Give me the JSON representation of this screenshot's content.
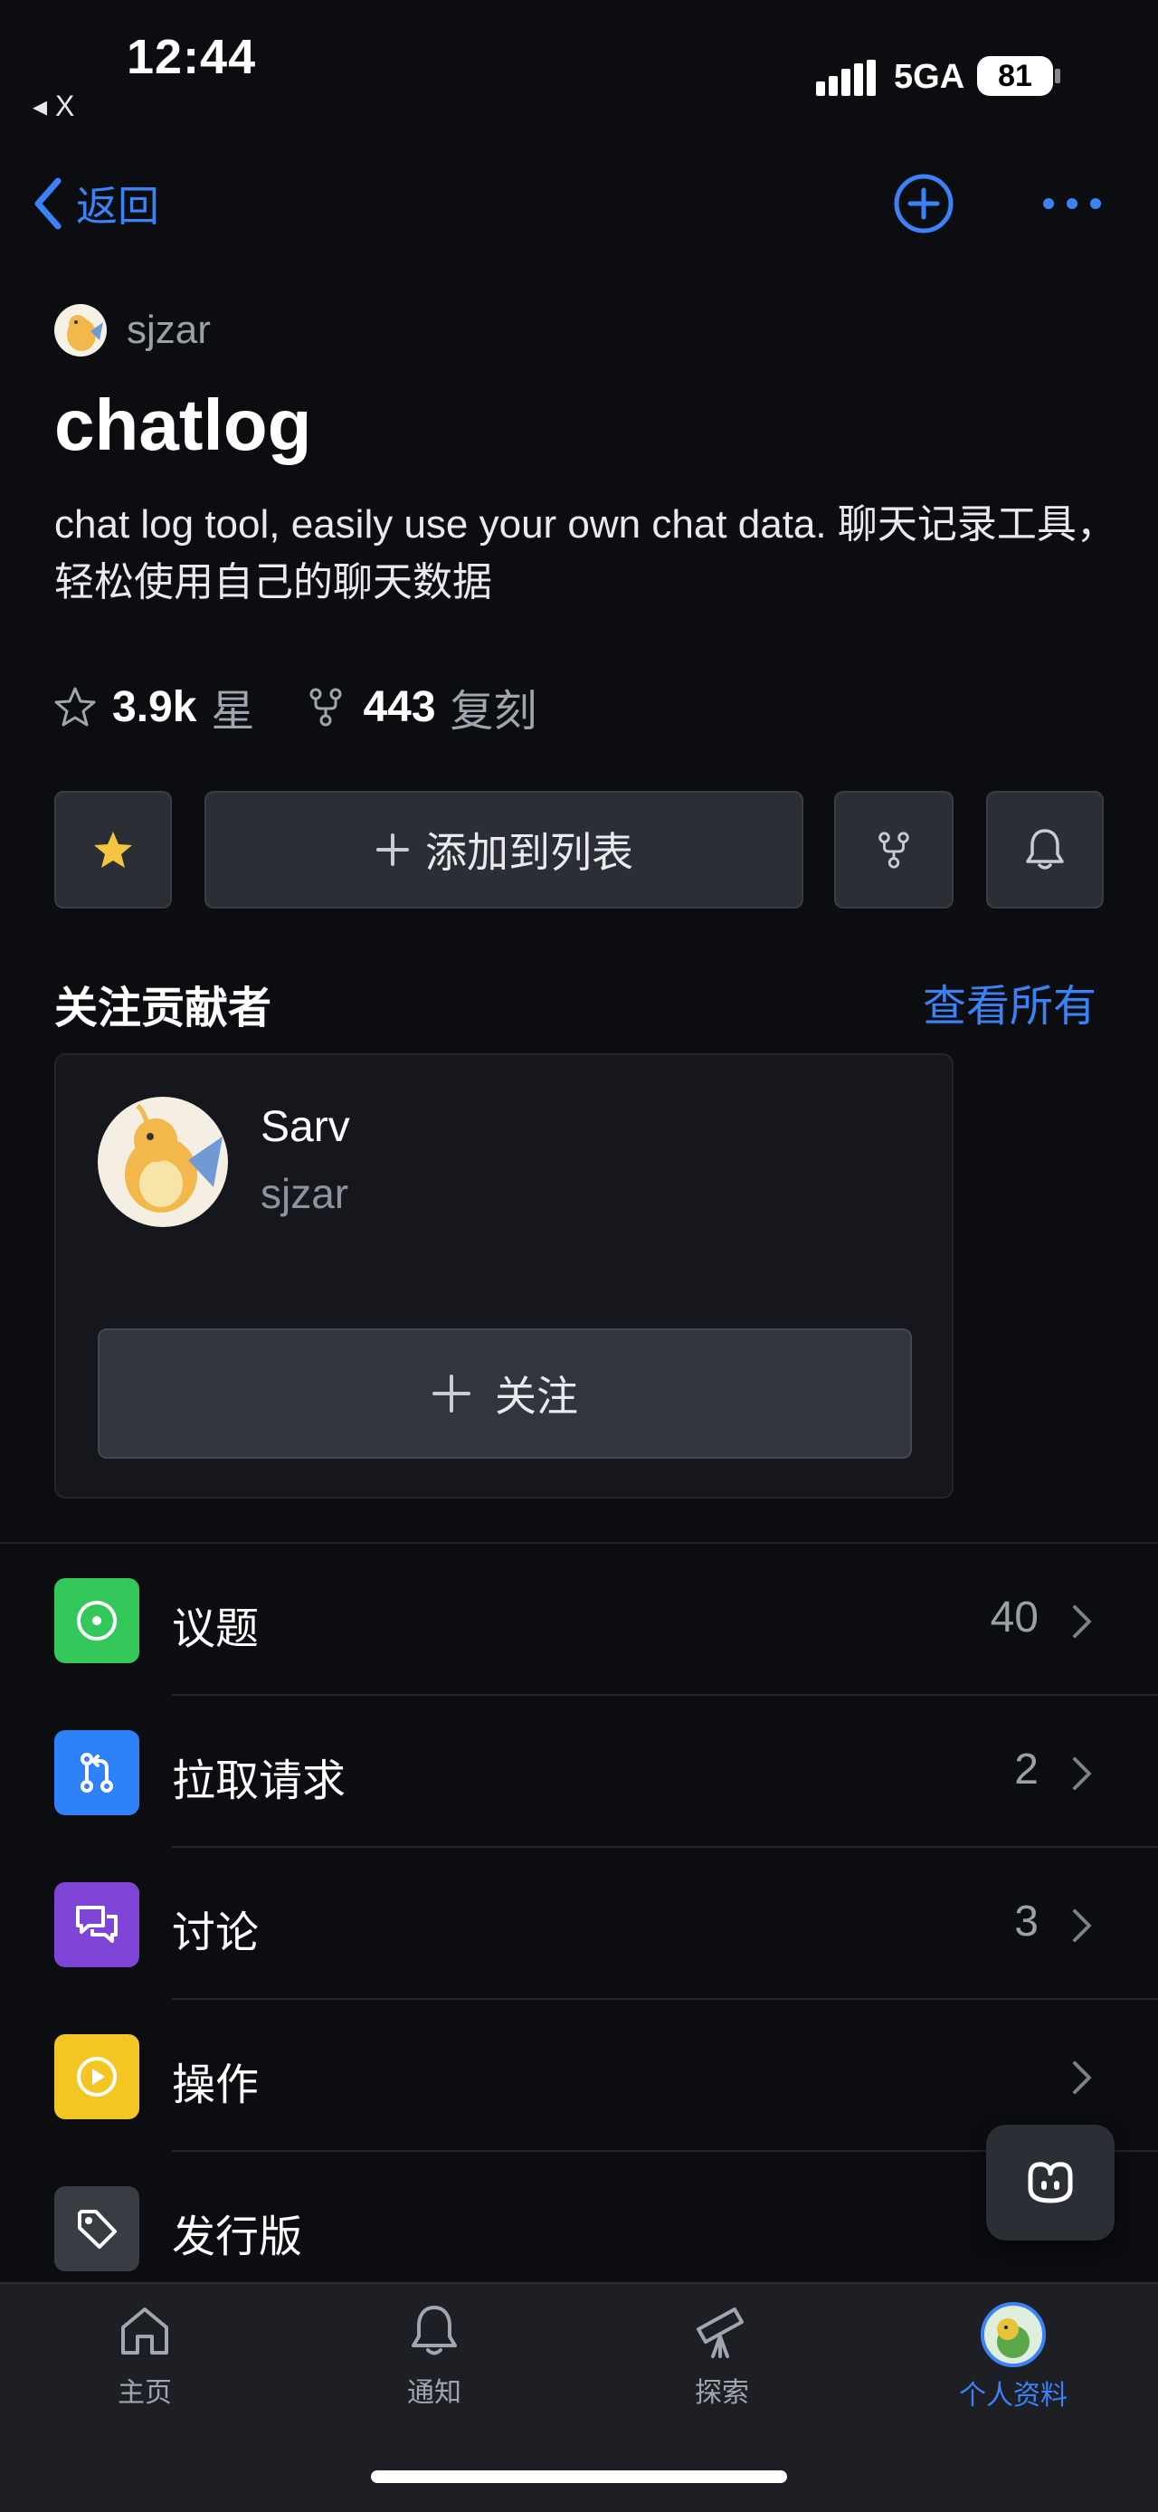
{
  "status_bar": {
    "time": "12:44",
    "back_app": "◂ X",
    "network": "5GA",
    "battery": "81"
  },
  "nav": {
    "back_label": "返回"
  },
  "repo": {
    "owner": "sjzar",
    "name": "chatlog",
    "description": "chat log tool, easily use your own chat data. 聊天记录工具，轻松使用自己的聊天数据",
    "stars": "3.9k",
    "stars_label": "星",
    "forks": "443",
    "forks_label": "复刻"
  },
  "actions": {
    "add_to_list": "添加到列表"
  },
  "contributors": {
    "section_title": "关注贡献者",
    "see_all": "查看所有",
    "card": {
      "name": "Sarv",
      "login": "sjzar",
      "follow_label": "关注"
    }
  },
  "menu": [
    {
      "label": "议题",
      "count": "40",
      "icon": "issue-icon",
      "color": "#34c759"
    },
    {
      "label": "拉取请求",
      "count": "2",
      "icon": "pull-request-icon",
      "color": "#2f81f7"
    },
    {
      "label": "讨论",
      "count": "3",
      "icon": "discussion-icon",
      "color": "#7e44d6"
    },
    {
      "label": "操作",
      "count": "",
      "icon": "actions-play-icon",
      "color": "#f3c623"
    },
    {
      "label": "发行版",
      "count": "",
      "icon": "tag-icon",
      "color": "#3a3c43"
    }
  ],
  "tabbar": [
    {
      "label": "主页",
      "icon": "home-icon"
    },
    {
      "label": "通知",
      "icon": "bell-icon"
    },
    {
      "label": "探索",
      "icon": "telescope-icon"
    },
    {
      "label": "个人资料",
      "icon": "profile-avatar"
    }
  ],
  "colors": {
    "accent": "#3b82f6",
    "star": "#f5c542"
  }
}
